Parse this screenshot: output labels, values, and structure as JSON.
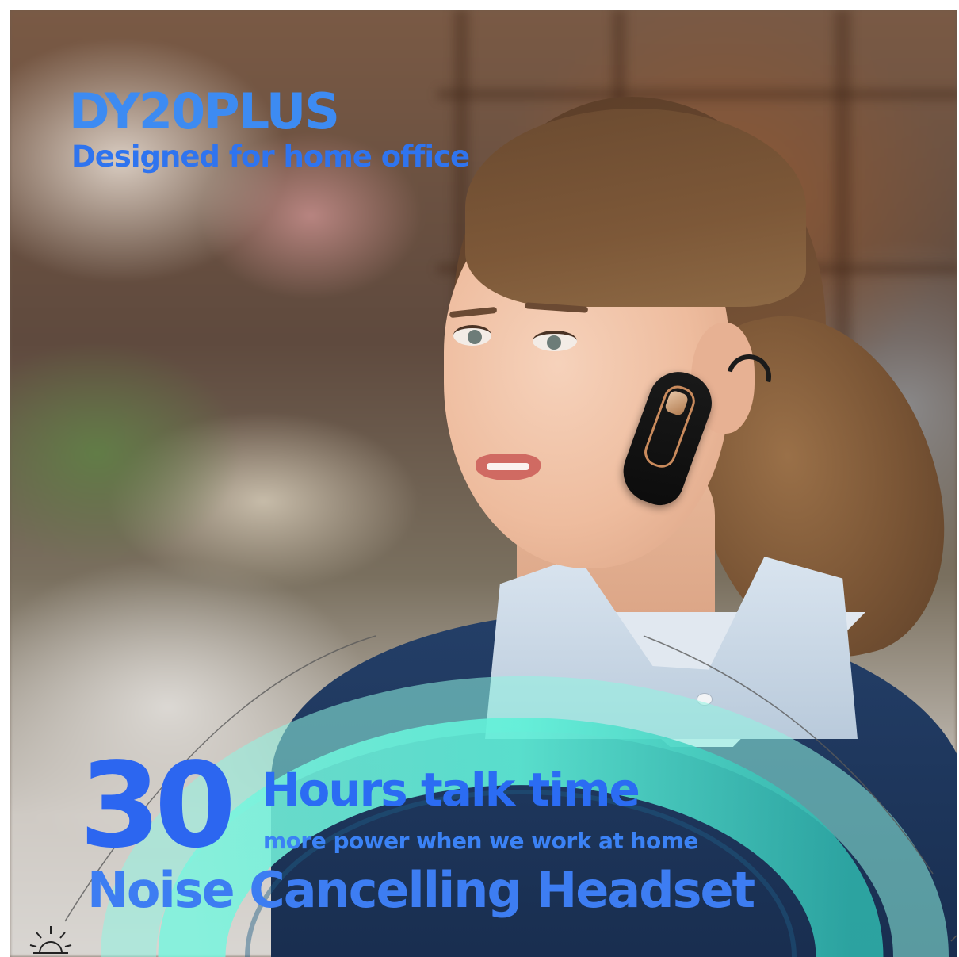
{
  "image": {
    "title": "DY20PLUS",
    "subtitle": "Designed for home office",
    "hours_number": "30",
    "hours_label": "Hours talk time",
    "hours_tagline": "more power when we work at home",
    "product_name": "Noise Cancelling Headset",
    "colors": {
      "title_blue": "#3d8bf2",
      "number_blue": "#2c66f0",
      "ring_teal": "#5ff0d8",
      "ring_teal_dark": "#2fb7ae"
    },
    "icons": {
      "corner": "sun-icon"
    }
  }
}
